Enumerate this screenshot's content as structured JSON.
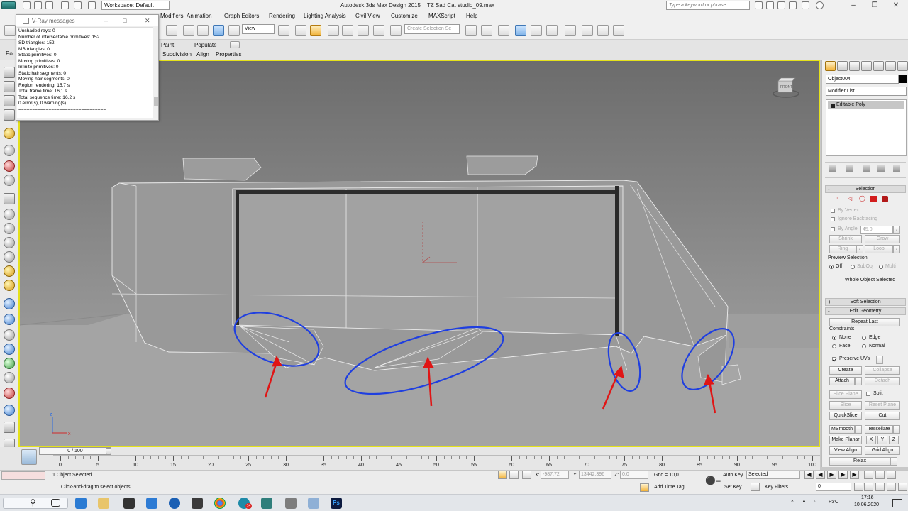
{
  "app": {
    "title": "Autodesk 3ds Max Design 2015",
    "file": "TZ Sad Cat studio_09.max",
    "logo": "MAX",
    "workspace": "Workspace: Default",
    "search_placeholder": "Type a keyword or phrase"
  },
  "menu": [
    "Modifiers",
    "Animation",
    "Graph Editors",
    "Rendering",
    "Lighting Analysis",
    "Civil View",
    "Customize",
    "MAXScript",
    "Help"
  ],
  "toolbar": {
    "view_select": "View",
    "named_selection_placeholder": "Create Selection Se",
    "snap_label": "3"
  },
  "ribbon": {
    "tabs": [
      "Paint",
      "Populate"
    ],
    "subtabs": [
      "Subdivision",
      "Align",
      "Properties"
    ],
    "left_label": "Pol"
  },
  "vray_window": {
    "title": "V-Ray messages",
    "lines": [
      "Unshaded rays: 0",
      "Number of intersectable primitives: 152",
      "SD triangles: 152",
      "MB triangles: 0",
      "Static primitives: 0",
      "Moving primitives: 0",
      "Infinite primitives: 0",
      "Static hair segments: 0",
      "Moving hair segments: 0",
      "Region rendering: 15,7 s",
      "Total frame time: 16,1 s",
      "Total sequence time: 16,2 s",
      "0 error(s), 0 warning(s)",
      "================================"
    ]
  },
  "viewport": {
    "cube_label": "FRONT",
    "axis_x": "x",
    "axis_z": "z",
    "annotation_color": "#1f3fe0",
    "arrow_color": "#e01515",
    "border_color": "#e4e11a"
  },
  "command_panel": {
    "object_name": "Object004",
    "modifier_list": "Modifier List",
    "stack_item": "Editable Poly",
    "selection": {
      "title": "Selection",
      "by_vertex": "By Vertex",
      "ignore_backfacing": "Ignore Backfacing",
      "by_angle": "By Angle:",
      "angle_value": "45,0",
      "shrink": "Shrink",
      "grow": "Grow",
      "ring": "Ring",
      "loop": "Loop",
      "preview_title": "Preview Selection",
      "preview_off": "Off",
      "preview_subobj": "SubObj",
      "preview_multi": "Multi",
      "whole_object": "Whole Object Selected"
    },
    "soft_selection": "Soft Selection",
    "edit_geometry": {
      "title": "Edit Geometry",
      "repeat_last": "Repeat Last",
      "constraints": "Constraints",
      "none": "None",
      "edge": "Edge",
      "face": "Face",
      "normal": "Normal",
      "preserve_uvs": "Preserve UVs",
      "create": "Create",
      "collapse": "Collapse",
      "attach": "Attach",
      "detach": "Detach",
      "slice_plane": "Slice Plane",
      "split": "Split",
      "slice": "Slice",
      "reset_plane": "Reset Plane",
      "quickslice": "QuickSlice",
      "cut": "Cut",
      "msmooth": "MSmooth",
      "tessellate": "Tessellate",
      "make_planar": "Make Planar",
      "x": "X",
      "y": "Y",
      "z": "Z",
      "view_align": "View Align",
      "grid_align": "Grid Align",
      "relax": "Relax"
    }
  },
  "timeline": {
    "frame_range": "0 / 100",
    "ticks": [
      0,
      5,
      10,
      15,
      20,
      25,
      30,
      35,
      40,
      45,
      50,
      55,
      60,
      65,
      70,
      75,
      80,
      85,
      90,
      95,
      100
    ]
  },
  "status": {
    "selected": "1 Object Selected",
    "prompt": "Click-and-drag to select objects",
    "x_label": "X:",
    "x_value": "-987,72",
    "y_label": "Y:",
    "y_value": "13442,396",
    "z_label": "Z:",
    "z_value": "0,0",
    "grid": "Grid = 10,0",
    "add_time_tag": "Add Time Tag",
    "auto_key": "Auto Key",
    "set_key": "Set Key",
    "selected_dropdown": "Selected",
    "key_filters": "Key Filters...",
    "frame_value": "0"
  },
  "taskbar": {
    "language": "РУС",
    "time": "17:16",
    "date": "10.06.2020",
    "notifications": "14"
  }
}
